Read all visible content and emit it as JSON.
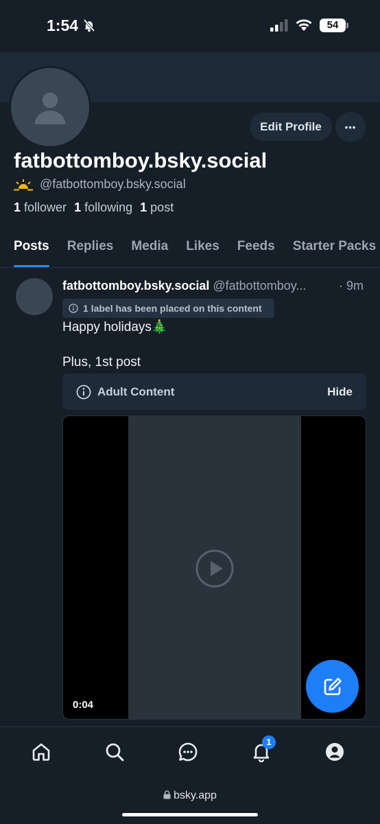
{
  "status_bar": {
    "time": "1:54",
    "battery": "54"
  },
  "profile": {
    "display_name": "fatbottomboy.bsky.social",
    "handle": "@fatbottomboy.bsky.social",
    "edit_label": "Edit Profile",
    "more_label": "•••",
    "followers_count": "1",
    "followers_label": "follower",
    "following_count": "1",
    "following_label": "following",
    "posts_count": "1",
    "posts_label": "post"
  },
  "tabs": [
    {
      "label": "Posts",
      "active": true
    },
    {
      "label": "Replies"
    },
    {
      "label": "Media"
    },
    {
      "label": "Likes"
    },
    {
      "label": "Feeds"
    },
    {
      "label": "Starter Packs"
    }
  ],
  "post": {
    "author": "fatbottomboy.bsky.social",
    "handle": "@fatbottomboy...",
    "time": "· 9m",
    "label_notice": "1 label has been placed on this content",
    "text_line1": "Happy holidays🎄",
    "text_line2": "Plus, 1st post",
    "warning_label": "Adult Content",
    "hide_label": "Hide",
    "video_time": "0:04"
  },
  "nav": {
    "notification_count": "1"
  },
  "browser": {
    "url": "bsky.app"
  },
  "colors": {
    "accent": "#1d7ef8",
    "background": "#161e27",
    "banner": "#1e2a37"
  }
}
